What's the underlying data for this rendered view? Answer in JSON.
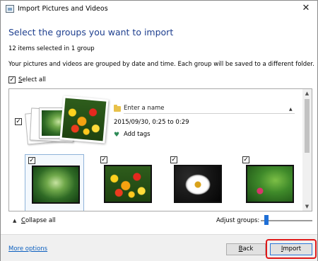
{
  "window": {
    "title": "Import Pictures and Videos",
    "close_glyph": "✕"
  },
  "header": {
    "heading": "Select the groups you want to import",
    "count_text": "12 items selected in 1 group",
    "info_text": "Your pictures and videos are grouped by date and time. Each group will be saved to a different folder."
  },
  "select_all": {
    "mnemonic": "S",
    "rest": "elect all",
    "checked": true
  },
  "group": {
    "name_placeholder": "Enter a name",
    "date_range": "2015/09/30, 0:25 to 0:29",
    "add_tags": "Add tags",
    "checked": true
  },
  "thumbnails": [
    {
      "subject": "forest",
      "checked": true,
      "selected": true
    },
    {
      "subject": "flowers",
      "checked": true,
      "selected": false
    },
    {
      "subject": "daisy",
      "checked": true,
      "selected": false
    },
    {
      "subject": "leaf",
      "checked": true,
      "selected": false
    }
  ],
  "bottom_bar": {
    "collapse_mnemonic": "C",
    "collapse_rest": "ollapse all",
    "adjust_prefix": "Adjust ",
    "adjust_mnemonic": "g",
    "adjust_rest": "roups:"
  },
  "footer": {
    "more_options": "More options",
    "back_mnemonic": "B",
    "back_rest": "ack",
    "import_mnemonic": "I",
    "import_rest": "mport"
  },
  "icons": {
    "checkmark": "✓",
    "chevron_up": "▲",
    "chevron_down": "▼",
    "collapse": "▲",
    "tag": "♥"
  },
  "colors": {
    "heading": "#1e3f8f",
    "link": "#0b5fbf",
    "highlight": "#e01818",
    "slider": "#1f6fd6"
  }
}
